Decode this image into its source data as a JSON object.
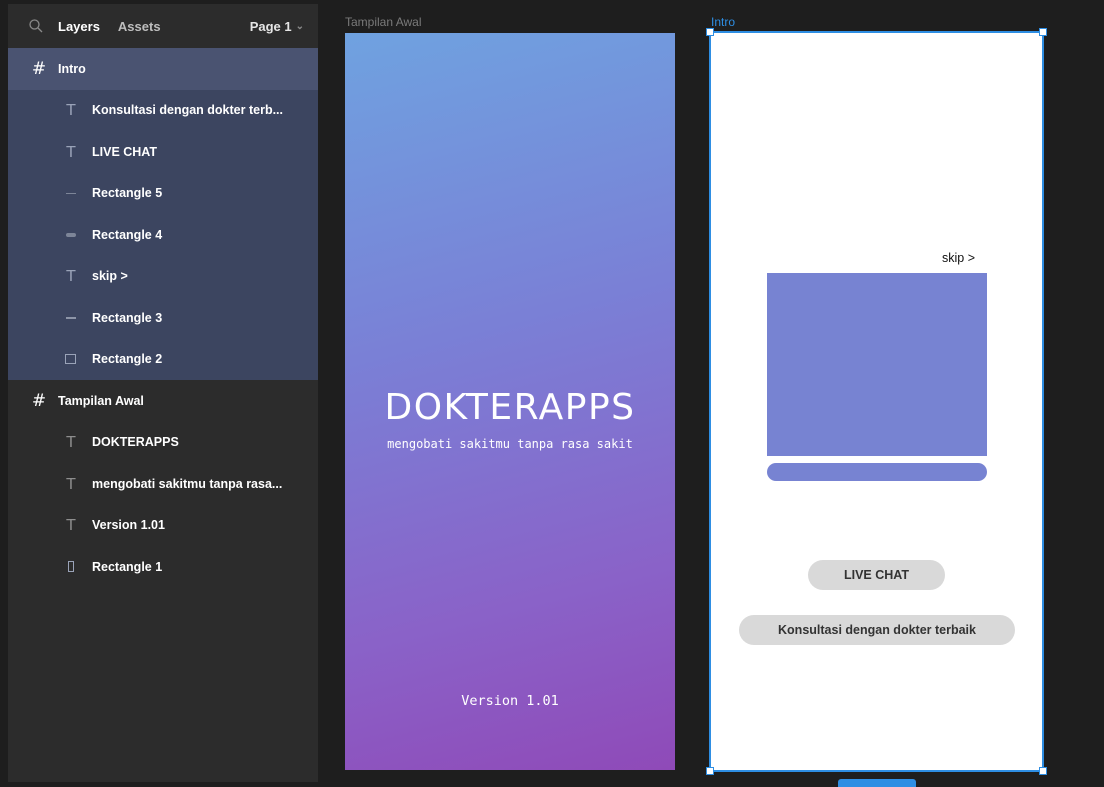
{
  "topbar": {
    "search_icon": "search-icon",
    "tab_layers": "Layers",
    "tab_assets": "Assets",
    "page_label": "Page 1",
    "page_chevron": "⌄"
  },
  "layers": {
    "intro_group": {
      "frame_label": "Intro",
      "children": [
        {
          "label": "Konsultasi dengan dokter terb...",
          "icon": "T"
        },
        {
          "label": "LIVE CHAT",
          "icon": "T"
        },
        {
          "label": "Rectangle 5",
          "icon": "line-thin"
        },
        {
          "label": "Rectangle 4",
          "icon": "pill"
        },
        {
          "label": "skip >",
          "icon": "T"
        },
        {
          "label": "Rectangle 3",
          "icon": "line"
        },
        {
          "label": "Rectangle 2",
          "icon": "box"
        }
      ]
    },
    "awal_group": {
      "frame_label": "Tampilan Awal",
      "children": [
        {
          "label": "DOKTERAPPS",
          "icon": "T"
        },
        {
          "label": "mengobati sakitmu tanpa rasa...",
          "icon": "T"
        },
        {
          "label": "Version 1.01",
          "icon": "T"
        },
        {
          "label": "Rectangle 1",
          "icon": "tall"
        }
      ]
    }
  },
  "canvas": {
    "awal_label": "Tampilan Awal",
    "intro_label": "Intro",
    "awal": {
      "title": "DOKTERAPPS",
      "subtitle": "mengobati sakitmu tanpa rasa sakit",
      "version": "Version 1.01"
    },
    "intro": {
      "skip": "skip >",
      "live_chat": "LIVE CHAT",
      "konsultasi": "Konsultasi dengan dokter terbaik"
    }
  },
  "colors": {
    "accent": "#2e8ee3",
    "selection_bg": "#3c4560",
    "rect_fill": "#7783d2"
  }
}
